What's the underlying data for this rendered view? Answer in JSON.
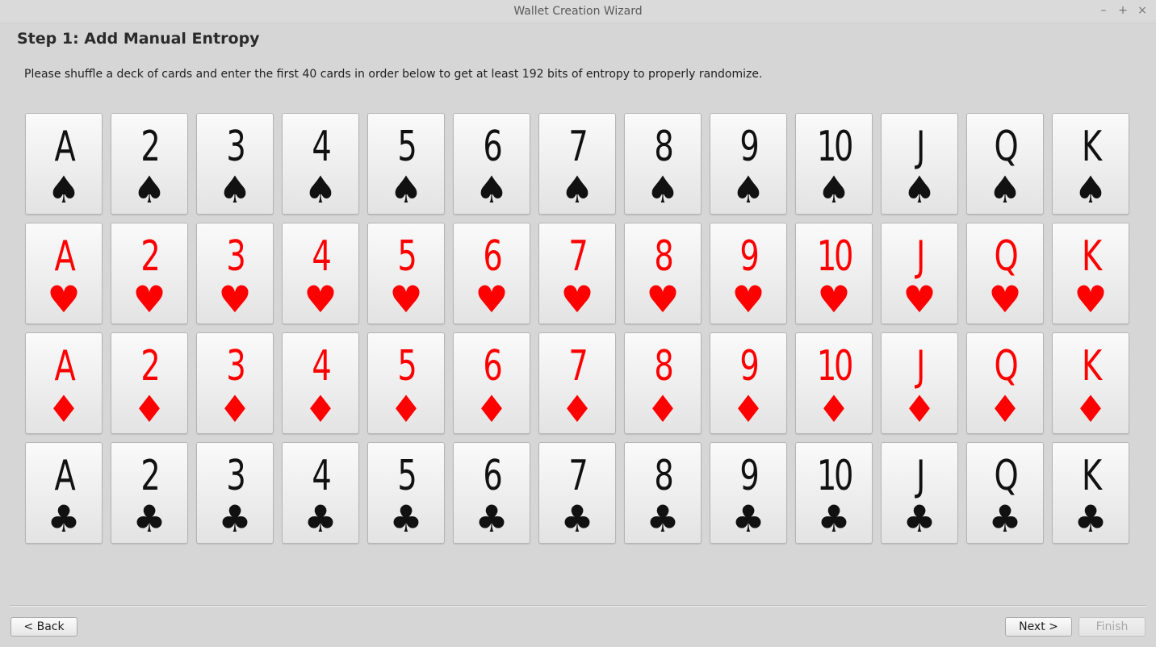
{
  "window": {
    "title": "Wallet Creation Wizard",
    "controls": [
      "–",
      "+",
      "×"
    ]
  },
  "heading": "Step 1: Add Manual Entropy",
  "instructions": "Please shuffle a deck of cards and enter the first 40 cards in order below to get at least 192 bits of entropy to properly randomize.",
  "colors": {
    "black_suit": "#111111",
    "red_suit": "#ff0000"
  },
  "ranks": [
    "A",
    "2",
    "3",
    "4",
    "5",
    "6",
    "7",
    "8",
    "9",
    "10",
    "J",
    "Q",
    "K"
  ],
  "suits": [
    {
      "name": "spades",
      "symbol": "♠",
      "color": "#111111"
    },
    {
      "name": "hearts",
      "symbol": "♥",
      "color": "#ff0000"
    },
    {
      "name": "diamonds",
      "symbol": "♦",
      "color": "#ff0000"
    },
    {
      "name": "clubs",
      "symbol": "♣",
      "color": "#111111"
    }
  ],
  "buttons": {
    "back": "< Back",
    "next": "Next >",
    "finish": "Finish"
  }
}
